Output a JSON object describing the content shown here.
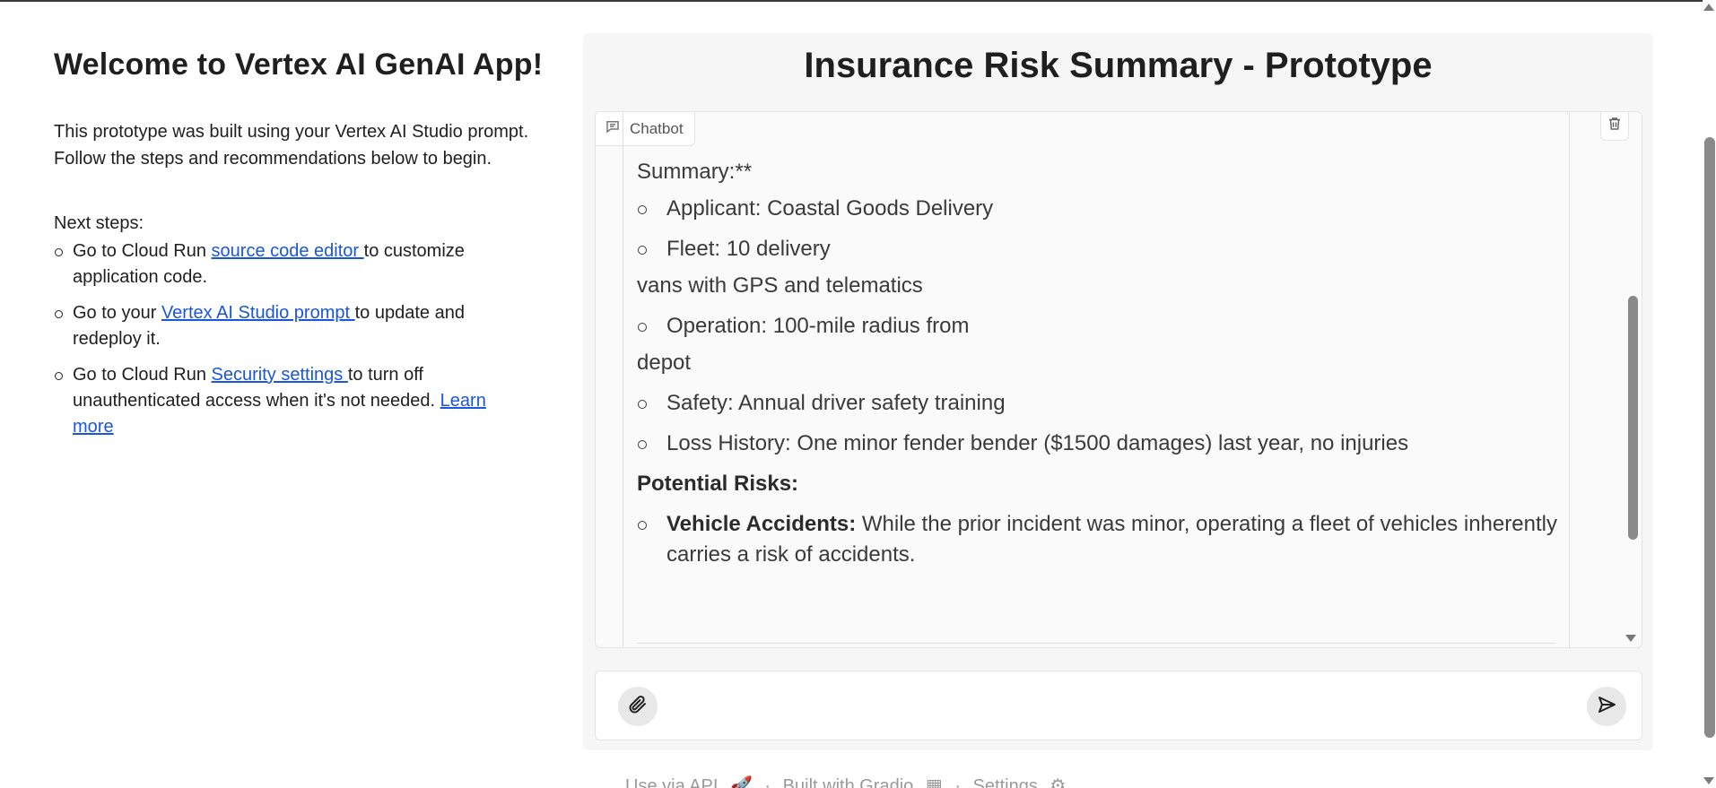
{
  "left": {
    "title": "Welcome to Vertex AI GenAI App!",
    "intro": "This prototype was built using your Vertex AI Studio prompt. Follow the steps and recommendations below to begin.",
    "next_steps_label": "Next steps:",
    "steps": [
      {
        "pre": "Go to Cloud Run ",
        "link": "source code editor ",
        "post": "to customize application code."
      },
      {
        "pre": "Go to your ",
        "link": "Vertex AI Studio prompt ",
        "post": "to update and redeploy it."
      },
      {
        "pre": "Go to Cloud Run ",
        "link": "Security settings ",
        "post": "to turn off unauthenticated access when it's not needed. ",
        "link2": "Learn more"
      }
    ]
  },
  "main": {
    "title": "Insurance Risk Summary - Prototype",
    "chatbot_label": "Chatbot",
    "messages": {
      "line1": "Summary:**",
      "bullet1": "Applicant: Coastal Goods Delivery",
      "bullet2": "Fleet: 10 delivery",
      "line2": "vans with GPS and telematics",
      "bullet3": "Operation: 100-mile radius from",
      "line3": "depot",
      "bullet4": "Safety: Annual driver safety training",
      "bullet5": "Loss History: One minor fender bender ($1500 damages) last year, no injuries",
      "heading": "Potential Risks:",
      "risk_label": "Vehicle Accidents:",
      "risk_text": " While the prior incident was minor, operating a fleet of vehicles inherently carries a risk of accidents."
    },
    "input": {
      "placeholder": "",
      "value": ""
    }
  },
  "footer": {
    "api": "Use via API",
    "gradio": "Built with Gradio",
    "settings": "Settings",
    "sep": "·"
  },
  "icons": [
    "chat-icon",
    "trash-icon",
    "paperclip-icon",
    "send-icon",
    "rocket-icon",
    "gradio-logo-icon",
    "gear-icon"
  ]
}
